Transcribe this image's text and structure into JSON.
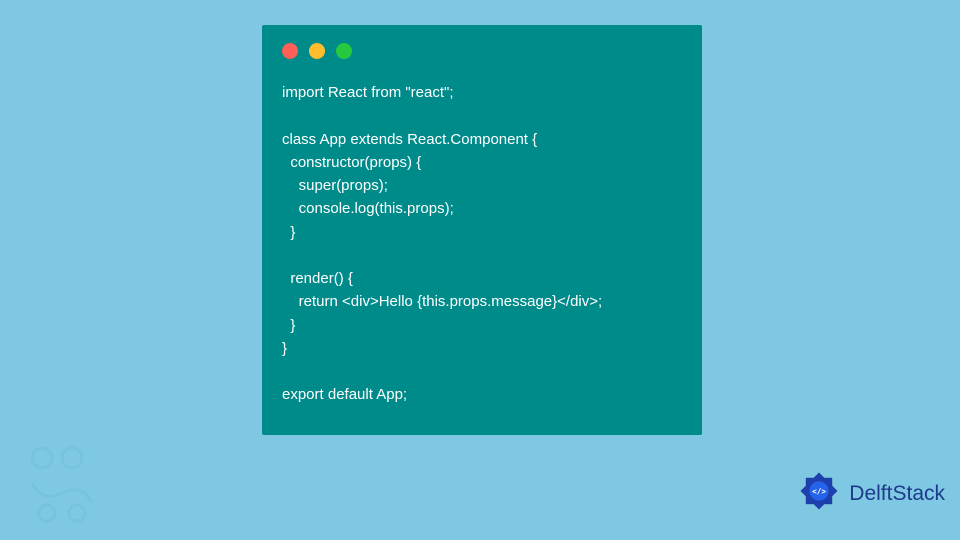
{
  "window": {
    "dots": {
      "red": "close",
      "yellow": "minimize",
      "green": "maximize"
    }
  },
  "code": {
    "line1": "import React from \"react\";",
    "line2": "",
    "line3": "class App extends React.Component {",
    "line4": "  constructor(props) {",
    "line5": "    super(props);",
    "line6": "    console.log(this.props);",
    "line7": "  }",
    "line8": "",
    "line9": "  render() {",
    "line10": "    return <div>Hello {this.props.message}</div>;",
    "line11": "  }",
    "line12": "}",
    "line13": "",
    "line14": "export default App;"
  },
  "brand": {
    "name": "DelftStack"
  }
}
